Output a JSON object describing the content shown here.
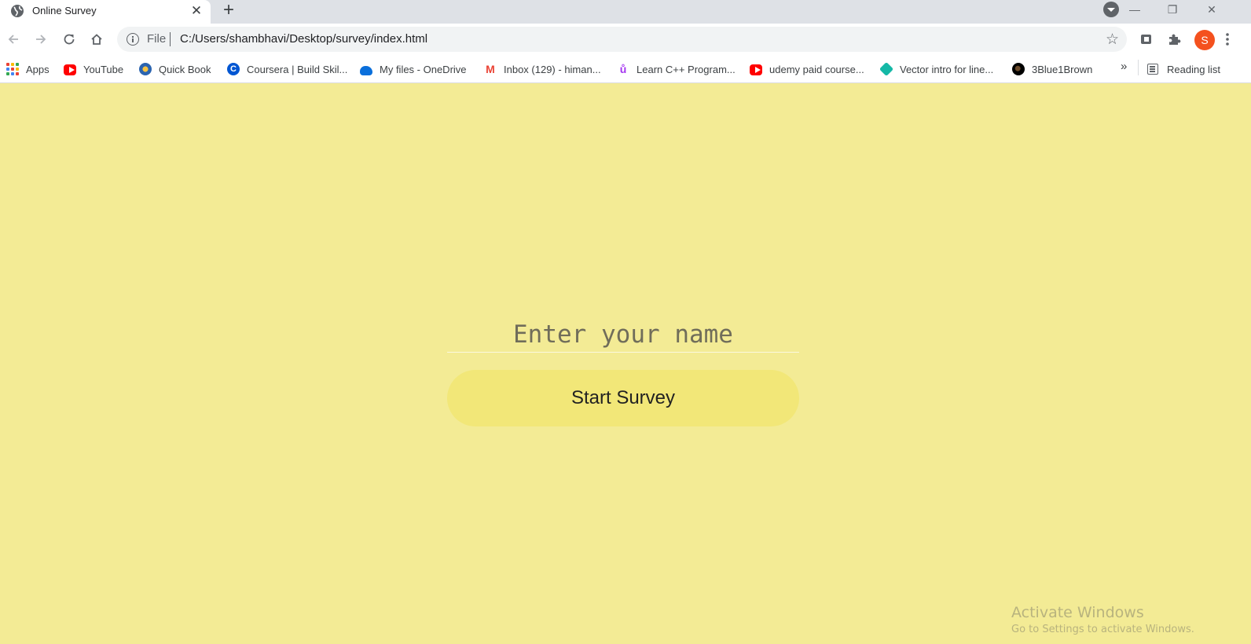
{
  "browser": {
    "tab": {
      "title": "Online Survey",
      "close": "✕"
    },
    "new_tab": "+",
    "window_controls": {
      "minimize": "—",
      "restore": "❐",
      "close": "✕"
    },
    "address": {
      "scheme": "File",
      "url": "C:/Users/shambhavi/Desktop/survey/index.html"
    },
    "profile_initial": "S",
    "bookmarks": [
      {
        "label": "Apps",
        "icon": "apps-grid-icon"
      },
      {
        "label": "YouTube",
        "icon": "youtube-icon"
      },
      {
        "label": "Quick Book",
        "icon": "quick-book-icon"
      },
      {
        "label": "Coursera | Build Skil...",
        "icon": "coursera-icon"
      },
      {
        "label": "My files - OneDrive",
        "icon": "onedrive-icon"
      },
      {
        "label": "Inbox (129) - himan...",
        "icon": "gmail-icon"
      },
      {
        "label": "Learn C++ Program...",
        "icon": "udemy-icon"
      },
      {
        "label": "udemy paid course...",
        "icon": "youtube-icon"
      },
      {
        "label": "Vector intro for line...",
        "icon": "vector-icon"
      },
      {
        "label": "3Blue1Brown",
        "icon": "3blue1brown-icon"
      }
    ],
    "more_bookmarks": "»",
    "reading_list": "Reading list"
  },
  "page": {
    "name_input": {
      "placeholder": "Enter your name",
      "value": ""
    },
    "start_button": "Start Survey"
  },
  "watermark": {
    "title": "Activate Windows",
    "subtitle": "Go to Settings to activate Windows."
  },
  "colors": {
    "page_background": "#f3eb95",
    "button_background": "#f2e778",
    "profile_avatar": "#f4511e"
  }
}
